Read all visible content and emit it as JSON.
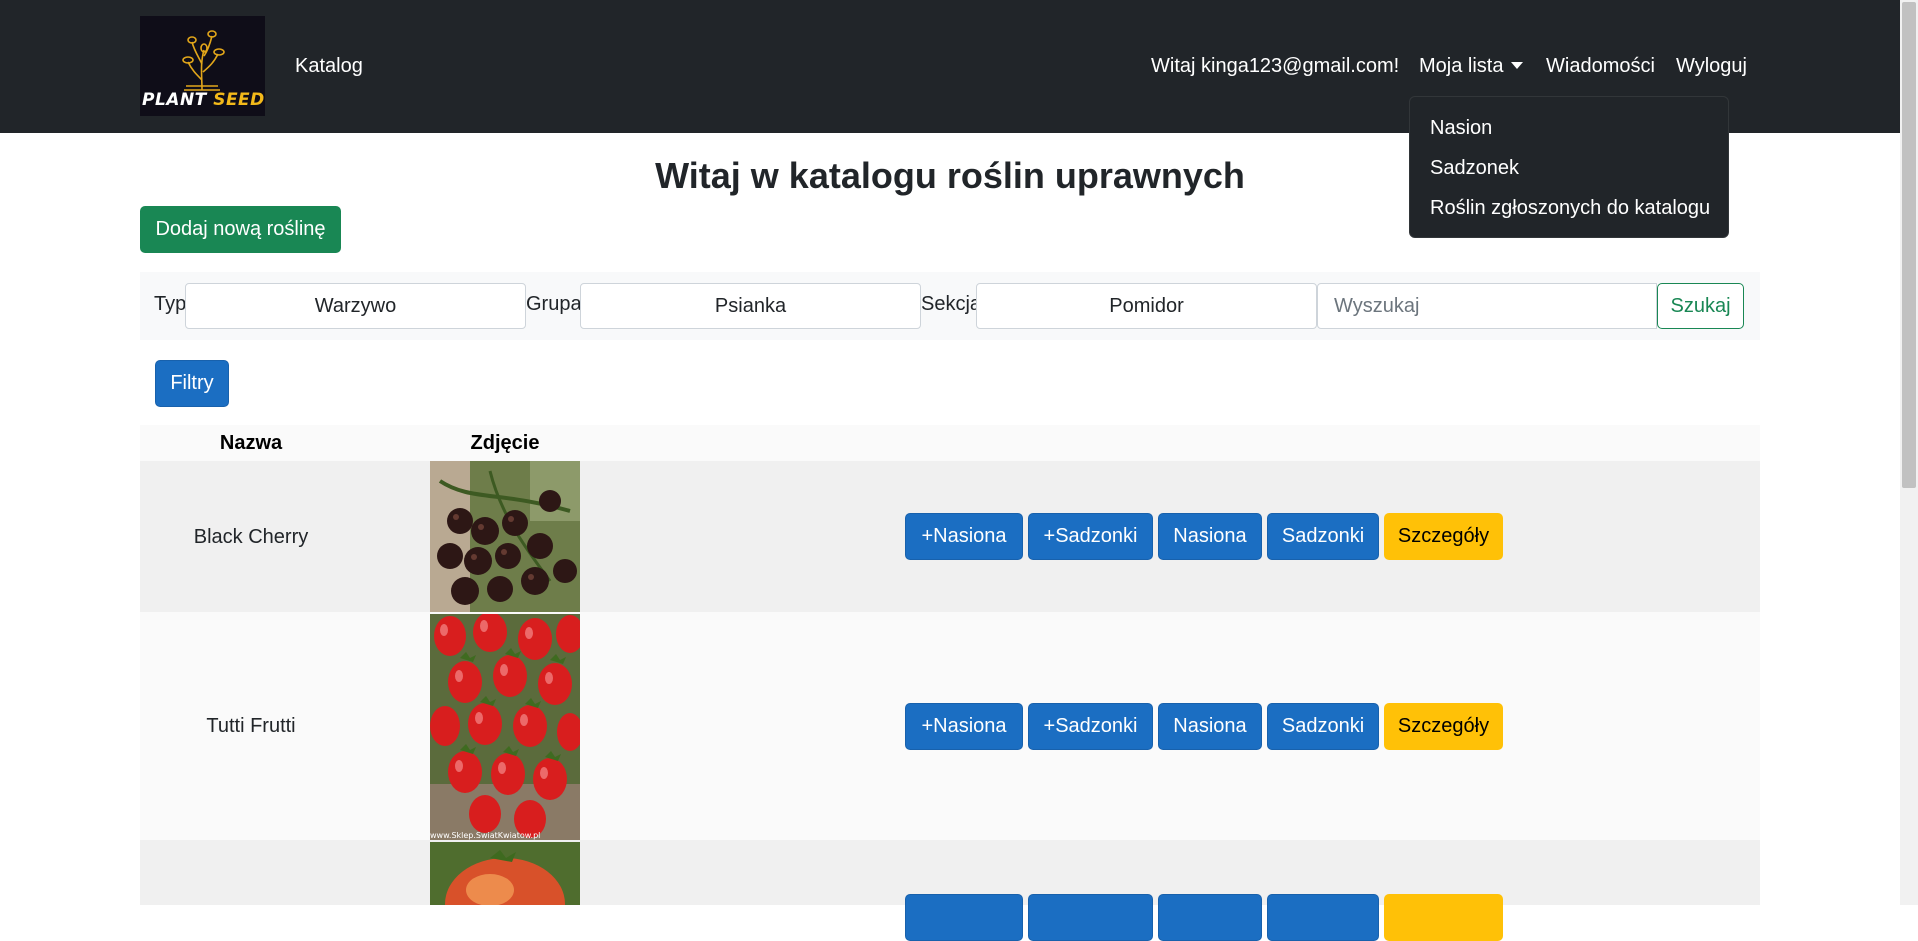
{
  "navbar": {
    "logo": {
      "word1": "PLANT",
      "word2": "SEEDER"
    },
    "catalog_link": "Katalog",
    "greeting": "Witaj kinga123@gmail.com!",
    "my_list": "Moja lista",
    "messages": "Wiadomości",
    "logout": "Wyloguj",
    "dropdown_items": [
      "Nasion",
      "Sadzonek",
      "Roślin zgłoszonych do katalogu"
    ]
  },
  "page": {
    "title": "Witaj w katalogu roślin uprawnych",
    "add_button": "Dodaj nową roślinę"
  },
  "filters": {
    "type_label": "Typ",
    "type_value": "Warzywo",
    "group_label": "Grupa",
    "group_value": "Psianka",
    "section_label": "Sekcja",
    "section_value": "Pomidor",
    "search_placeholder": "Wyszukaj",
    "search_button": "Szukaj",
    "filters_button": "Filtry"
  },
  "table": {
    "headers": {
      "name": "Nazwa",
      "photo": "Zdjęcie"
    },
    "rows": [
      {
        "name": "Black Cherry",
        "photo": "dark-cherry-tomatoes"
      },
      {
        "name": "Tutti Frutti",
        "photo": "red-plum-tomatoes",
        "watermark": "www.Sklep.SwiatKwiatow.pl"
      },
      {
        "name": "",
        "photo": "orange-red-tomato"
      }
    ],
    "actions": [
      "+Nasiona",
      "+Sadzonki",
      "Nasiona",
      "Sadzonki",
      "Szczegóły"
    ]
  },
  "colors": {
    "navbar": "#212529",
    "primary": "#1b6ec2",
    "success": "#198754",
    "warning": "#ffc107",
    "logo_accent": "#f3b91a"
  }
}
